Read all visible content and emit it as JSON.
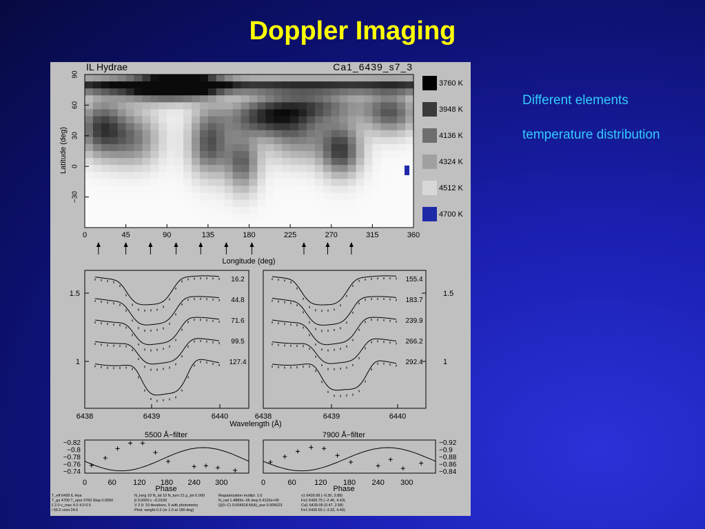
{
  "slide": {
    "title": "Doppler Imaging",
    "notes": [
      "Different elements",
      "temperature distribution"
    ]
  },
  "figure": {
    "star_name": "IL Hydrae",
    "dataset_label": "Ca1_6439_s7_3",
    "map": {
      "xlabel": "Longitude (deg)",
      "ylabel": "Latitude (deg)",
      "x_ticks": [
        "0",
        "45",
        "90",
        "135",
        "180",
        "225",
        "270",
        "315",
        "360"
      ],
      "y_ticks": [
        "90",
        "60",
        "30",
        "0",
        "−30"
      ],
      "observation_longitudes": [
        15,
        45,
        72,
        100,
        127,
        155,
        183,
        240,
        266,
        292
      ],
      "temperature_legend": [
        {
          "label": "3760 K",
          "color": "#000000"
        },
        {
          "label": "3948 K",
          "color": "#3a3a3a"
        },
        {
          "label": "4136 K",
          "color": "#6e6e6e"
        },
        {
          "label": "4324 K",
          "color": "#a0a0a0"
        },
        {
          "label": "4512 K",
          "color": "#d8d8d8"
        },
        {
          "label": "4700 K",
          "color": "#1f2aa8"
        }
      ]
    },
    "profiles": {
      "xlabel": "Wavelength (Å)",
      "x_ticks_left": [
        "6438",
        "6439",
        "6440"
      ],
      "x_ticks_right": [
        "6438",
        "6439",
        "6440"
      ],
      "y_ticks_left": [
        "1.5",
        "1"
      ],
      "y_ticks_right": [
        "1.5",
        "1"
      ],
      "left_phases": [
        "16.2",
        "44.8",
        "71.6",
        "99.5",
        "127.4"
      ],
      "right_phases": [
        "155.4",
        "183.7",
        "239.9",
        "266.2",
        "292.4"
      ]
    },
    "lightcurves": {
      "left_title": "5500 Å−filter",
      "right_title": "7900 Å−filter",
      "xlabel": "Phase",
      "x_ticks": [
        "0",
        "60",
        "120",
        "180",
        "240",
        "300"
      ],
      "y_ticks_left": [
        "−0.82",
        "−0.8",
        "−0.78",
        "−0.76",
        "−0.74"
      ],
      "y_ticks_right": [
        "−0.92",
        "−0.9",
        "−0.88",
        "−0.86",
        "−0.84"
      ],
      "left_points": [
        [
          15,
          -0.805
        ],
        [
          45,
          -0.786
        ],
        [
          72,
          -0.762
        ],
        [
          100,
          -0.748
        ],
        [
          127,
          -0.748
        ],
        [
          155,
          -0.772
        ],
        [
          183,
          -0.795
        ],
        [
          240,
          -0.808
        ],
        [
          266,
          -0.806
        ],
        [
          292,
          -0.811
        ],
        [
          330,
          -0.818
        ]
      ],
      "right_points": [
        [
          15,
          -0.895
        ],
        [
          45,
          -0.88
        ],
        [
          72,
          -0.866
        ],
        [
          100,
          -0.855
        ],
        [
          127,
          -0.858
        ],
        [
          155,
          -0.877
        ],
        [
          183,
          -0.895
        ],
        [
          240,
          -0.905
        ],
        [
          266,
          -0.888
        ],
        [
          292,
          -0.912
        ],
        [
          330,
          -0.898
        ]
      ]
    },
    "footer_lines": [
      "T_eff 6439 IL Hya",
      "T_gs 4700  T_spot 3760  Step 0.0050",
      "ξ 2.0  v_mac 4.0  4.0  0.5",
      "i 55.0  vsini 24.5",
      "N_long 10  N_lat 10  N_turn 21  μ_tot 0.000",
      "β 0.0000  ε −0.0100",
      "V 2.0: 10 iterations, 5 with photometry",
      "Phot. weight 0.2 (or 1.0 at 180 deg)",
      "Regularization multipl. 1.0",
      "N_rad 1.4883e−06  step 5.4115e+06",
      "Q(0−C) 0.004918  M(A)_ave 0.005623",
      "v1  6439.08 (−0.30, 3.88)",
      "Fe1  6439.75 (−2.46, 4.43)",
      "Ca1  6439.08 (0.47, 2.58)",
      "Fe1  6439.55 (−3.33, 4.40)"
    ]
  }
}
